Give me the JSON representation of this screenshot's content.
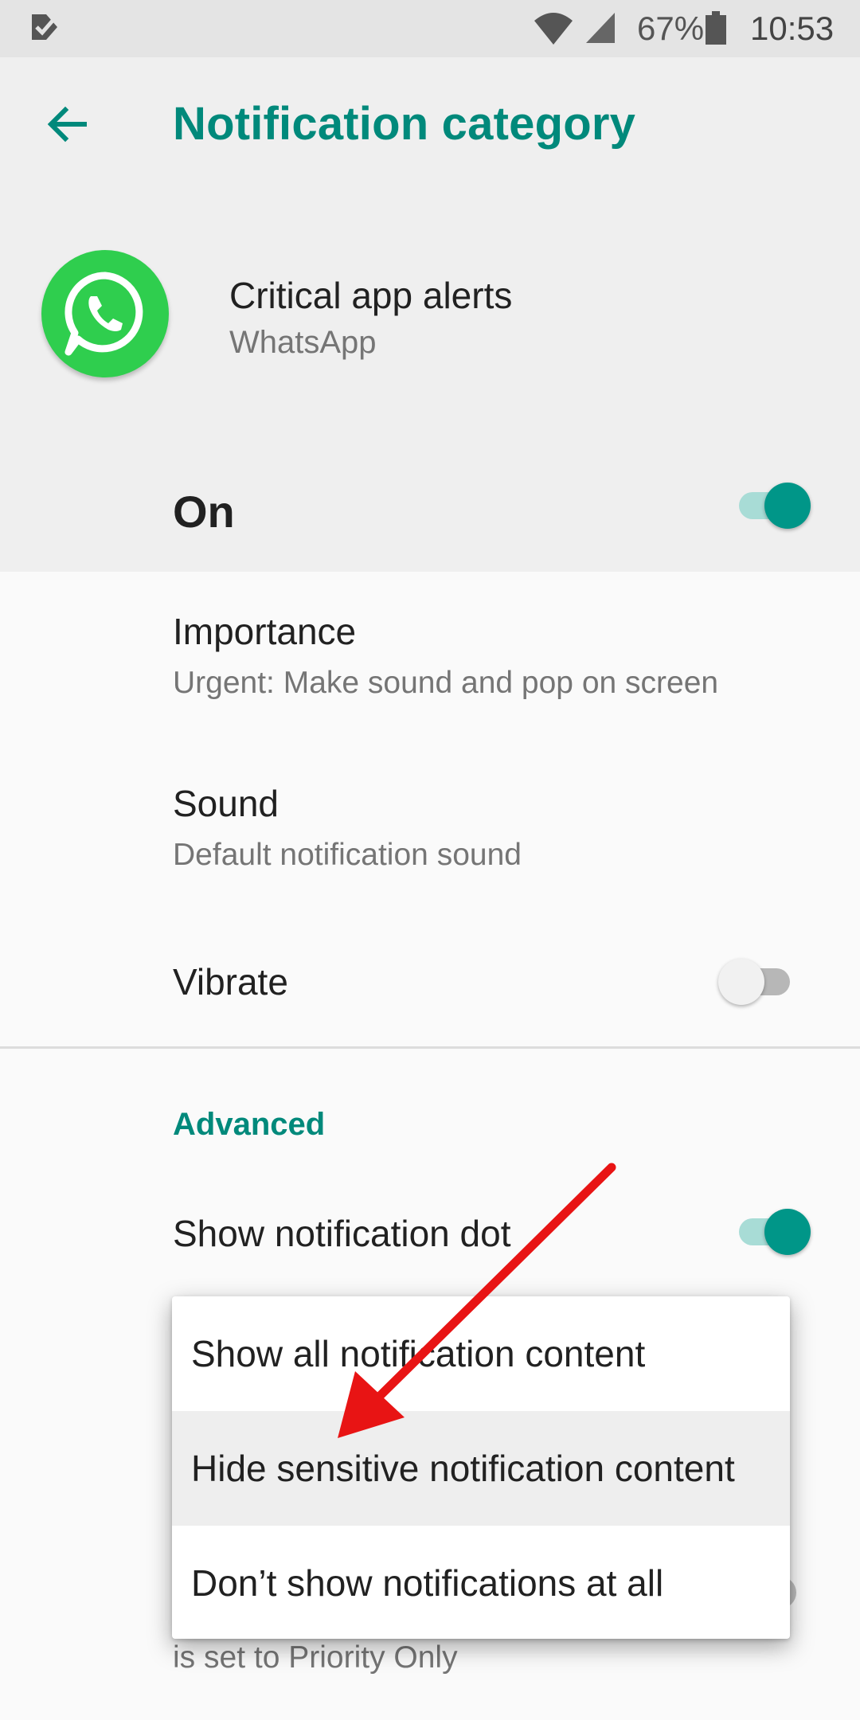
{
  "status_bar": {
    "battery_percent": "67%",
    "time": "10:53",
    "icons": [
      "notification-check-icon",
      "wifi-icon",
      "cell-signal-icon",
      "battery-icon"
    ]
  },
  "header": {
    "title": "Notification category",
    "back_icon": "arrow-back-icon"
  },
  "app": {
    "category_name": "Critical app alerts",
    "app_name": "WhatsApp",
    "icon": "whatsapp-logo-icon"
  },
  "master_toggle": {
    "label": "On",
    "state": true
  },
  "preferences": {
    "importance": {
      "title": "Importance",
      "summary": "Urgent: Make sound and pop on screen"
    },
    "sound": {
      "title": "Sound",
      "summary": "Default notification sound"
    },
    "vibrate": {
      "title": "Vibrate",
      "state": false
    }
  },
  "advanced": {
    "header": "Advanced",
    "notification_dot": {
      "title": "Show notification dot",
      "state": true
    },
    "obscured_summary": "is set to Priority Only"
  },
  "popup_menu": {
    "items": [
      "Show all notification content",
      "Hide sensitive notification content",
      "Don’t show notifications at all"
    ],
    "selected_index": 1
  },
  "colors": {
    "accent": "#00897b",
    "switch_on_thumb": "#009688",
    "switch_on_track": "#a8dcd6",
    "annotation_arrow": "#e81414",
    "whatsapp_green": "#2fce4e"
  }
}
